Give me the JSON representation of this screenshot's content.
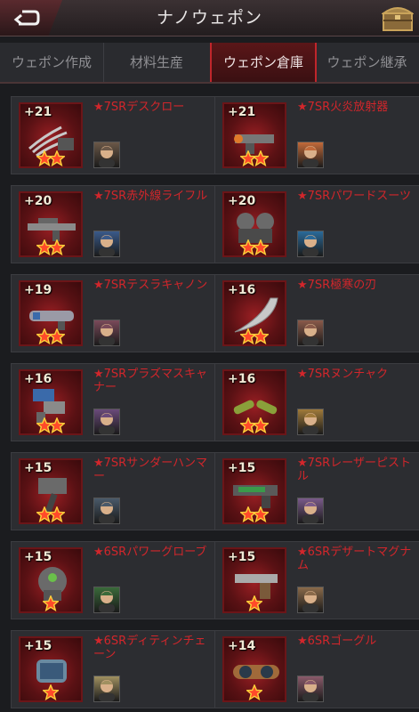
{
  "header": {
    "title": "ナノウェポン"
  },
  "tabs": [
    {
      "label": "ウェポン作成",
      "active": false
    },
    {
      "label": "材料生産",
      "active": false
    },
    {
      "label": "ウェポン倉庫",
      "active": true
    },
    {
      "label": "ウェポン継承",
      "active": false
    }
  ],
  "colors": {
    "accent": "#d2262b",
    "background": "#1b1c1f",
    "card": "#2c2d31"
  },
  "weapons": [
    {
      "level": "+21",
      "name": "★7SRデスクロー",
      "stars": 2,
      "icon": "claw-icon",
      "avatar_color": "#6b5848"
    },
    {
      "level": "+21",
      "name": "★7SR火炎放射器",
      "stars": 2,
      "icon": "flamethrower-icon",
      "avatar_color": "#c26a3a"
    },
    {
      "level": "+20",
      "name": "★7SR赤外線ライフル",
      "stars": 2,
      "icon": "rifle-icon",
      "avatar_color": "#3a5a8a"
    },
    {
      "level": "+20",
      "name": "★7SRパワードスーツ",
      "stars": 2,
      "icon": "armor-icon",
      "avatar_color": "#2a6a9a"
    },
    {
      "level": "+19",
      "name": "★7SRテスラキャノン",
      "stars": 2,
      "icon": "cannon-icon",
      "avatar_color": "#7a4a5a"
    },
    {
      "level": "+16",
      "name": "★7SR極寒の刃",
      "stars": 2,
      "icon": "blade-icon",
      "avatar_color": "#8a5a4a"
    },
    {
      "level": "+16",
      "name": "★7SRプラズマスキャナー",
      "stars": 2,
      "icon": "scanner-icon",
      "avatar_color": "#6a4a7a"
    },
    {
      "level": "+16",
      "name": "★7SRヌンチャク",
      "stars": 2,
      "icon": "nunchaku-icon",
      "avatar_color": "#a07a3a"
    },
    {
      "level": "+15",
      "name": "★7SRサンダーハンマー",
      "stars": 2,
      "icon": "hammer-icon",
      "avatar_color": "#4a5a6a"
    },
    {
      "level": "+15",
      "name": "★7SRレーザーピストル",
      "stars": 2,
      "icon": "laser-pistol-icon",
      "avatar_color": "#7a5a8a"
    },
    {
      "level": "+15",
      "name": "★6SRパワーグローブ",
      "stars": 1,
      "icon": "glove-icon",
      "avatar_color": "#3a6a3a"
    },
    {
      "level": "+15",
      "name": "★6SRデザートマグナム",
      "stars": 1,
      "icon": "magnum-icon",
      "avatar_color": "#8a6a4a"
    },
    {
      "level": "+15",
      "name": "★6SRディティンチェーン",
      "stars": 1,
      "icon": "chain-icon",
      "avatar_color": "#a09060"
    },
    {
      "level": "+14",
      "name": "★6SRゴーグル",
      "stars": 1,
      "icon": "goggles-icon",
      "avatar_color": "#8a5a6a"
    }
  ]
}
